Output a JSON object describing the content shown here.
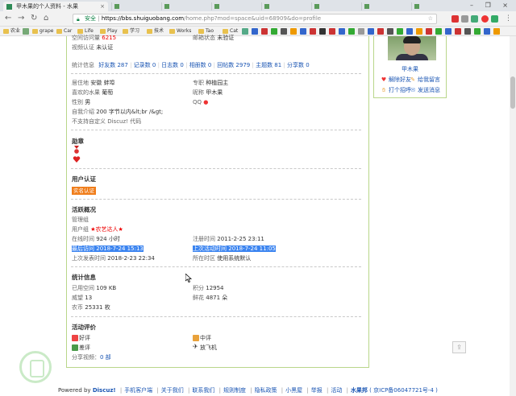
{
  "browser": {
    "tab_title": "甲木果的个人资料 - 水果",
    "tab_close": "×",
    "window_controls": "– ❐ ×",
    "url_security": "安全",
    "url_host": "https://bbs.shuiguobang.com",
    "url_path": "/home.php?mod=space&uid=68909&do=profile",
    "bookmarks": [
      "农业",
      "grape",
      "Car",
      "Life",
      "Play",
      "学习",
      "技术",
      "Works",
      "Tao",
      "Cat"
    ]
  },
  "profile": {
    "top": {
      "space_visits_label": "空间访问量",
      "space_visits_value": "6215",
      "email_status_label": "邮箱状态",
      "email_status_value": "未验证",
      "video_auth_label": "视频认证",
      "video_auth_value": "未认证"
    },
    "stats_line": {
      "label": "统计信息",
      "items": [
        "好友数 287",
        "记录数 0",
        "日志数 0",
        "相册数 0",
        "回帖数 2979",
        "主题数 81",
        "分享数 0"
      ]
    },
    "info": {
      "residence_label": "居住地",
      "residence_value": "安徽 蚌埠",
      "specialty_label": "专职",
      "specialty_value": "种植园主",
      "fav_fruit_label": "喜欢的水果",
      "fav_fruit_value": "葡萄",
      "nickname_label": "昵称",
      "nickname_value": "甲木果",
      "gender_label": "性别",
      "gender_value": "男",
      "qq_label": "QQ",
      "intro_label": "自我介绍",
      "intro_value": "200 字节以内&lt;br /&gt;",
      "custom_note": "不支持自定义 Discuz! 代码"
    },
    "medals": {
      "title": "勋章"
    },
    "user_auth": {
      "title": "用户认证",
      "badge": "实名认证"
    },
    "activity": {
      "title": "活跃概况",
      "group_manage": "管理组",
      "user_group_label": "用户组",
      "user_group_value": "★农艺达人★",
      "online_time_label": "在线时间",
      "online_time_value": "924 小时",
      "register_time_label": "注册时间",
      "register_time_value": "2011-2-25 23:11",
      "last_visit_label": "最后访问",
      "last_visit_value": "2018-7-24 15:13",
      "last_active_label": "上次活动时间",
      "last_active_value": "2018-7-24 11:05",
      "last_post_label": "上次发表时间",
      "last_post_value": "2018-2-23 22:34",
      "timezone_label": "所在时区",
      "timezone_value": "使用系统默认"
    },
    "stats": {
      "title": "统计信息",
      "used_space_label": "已用空间",
      "used_space_value": "109 KB",
      "points_label": "积分",
      "points_value": "12954",
      "prestige_label": "威望",
      "prestige_value": "13",
      "flowers_label": "鲜花",
      "flowers_value": "4871 朵",
      "coins_label": "农币",
      "coins_value": "25331 枚"
    },
    "evaluation": {
      "title": "活动评价",
      "good": "好评",
      "medium": "中评",
      "bad": "差评",
      "fly": "放飞机",
      "share_videos_label": "分享视频：",
      "share_videos_value": "0 部"
    }
  },
  "sidebar": {
    "username": "甲木果",
    "unfriend": "解除好友",
    "message": "给我留言",
    "greet": "打个招呼",
    "send_msg": "发送消息"
  },
  "footer": {
    "powered_prefix": "Powered by",
    "powered_brand": "Discuz!",
    "links": [
      "手机客户端",
      "关于我们",
      "联系我们",
      "规则制度",
      "隐私政策",
      "小黑屋",
      "举报",
      "活动"
    ],
    "site_name": "水果邦",
    "icp": "( 京ICP备06047721号-4 )"
  },
  "colors": {
    "accent_green": "#b9d68a",
    "link_blue": "#1a55b3",
    "highlight": "#3b84f0",
    "red": "#e00000",
    "badge_orange": "#f07d1a"
  }
}
